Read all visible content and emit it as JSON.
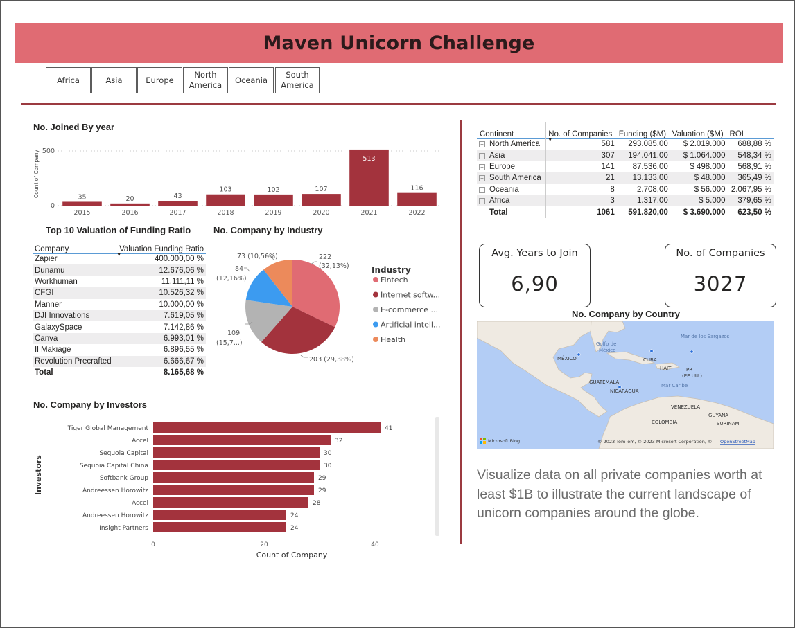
{
  "title": "Maven Unicorn Challenge",
  "slicers": [
    {
      "label": "Africa"
    },
    {
      "label": "Asia"
    },
    {
      "label": "Europe"
    },
    {
      "label": "North America"
    },
    {
      "label": "Oceania"
    },
    {
      "label": "South America"
    }
  ],
  "joined": {
    "title": "No. Joined By year",
    "ylabel": "Count of Company",
    "yticks": [
      "0",
      "500"
    ],
    "chart_data": {
      "type": "bar",
      "categories": [
        "2015",
        "2016",
        "2017",
        "2018",
        "2019",
        "2020",
        "2021",
        "2022"
      ],
      "values": [
        35,
        20,
        43,
        103,
        102,
        107,
        513,
        116
      ],
      "ylabel": "Count of Company",
      "ylim": [
        0,
        520
      ],
      "color": "#a3333d",
      "grid": true
    }
  },
  "top10": {
    "title": "Top 10 Valuation of Funding Ratio",
    "headers": {
      "company": "Company",
      "ratio": "Valuation Funding Ratio"
    },
    "rows": [
      {
        "company": "Zapier",
        "ratio": "400.000,00 %"
      },
      {
        "company": "Dunamu",
        "ratio": "12.676,06 %"
      },
      {
        "company": "Workhuman",
        "ratio": "11.111,11 %"
      },
      {
        "company": "CFGI",
        "ratio": "10.526,32 %"
      },
      {
        "company": "Manner",
        "ratio": "10.000,00 %"
      },
      {
        "company": "DJI Innovations",
        "ratio": "7.619,05 %"
      },
      {
        "company": "GalaxySpace",
        "ratio": "7.142,86 %"
      },
      {
        "company": "Canva",
        "ratio": "6.993,01 %"
      },
      {
        "company": "Il Makiage",
        "ratio": "6.896,55 %"
      },
      {
        "company": "Revolution Precrafted",
        "ratio": "6.666,67 %"
      }
    ],
    "total": {
      "label": "Total",
      "ratio": "8.165,68 %"
    }
  },
  "industry": {
    "title": "No. Company by Industry",
    "legend_title": "Industry",
    "legend": [
      "Fintech",
      "Internet softw...",
      "E-commerce ...",
      "Artificial intell...",
      "Health"
    ],
    "slice_labels": [
      {
        "line1": "222",
        "line2": "(32,13%)"
      },
      {
        "line1": "203 (29,38%)",
        "line2": ""
      },
      {
        "line1": "109",
        "line2": "(15,7...)"
      },
      {
        "line1": "84",
        "line2": "(12,16%)"
      },
      {
        "line1": "73 (10,56%)",
        "line2": ""
      }
    ],
    "chart_data": {
      "type": "pie",
      "labels": [
        "Fintech",
        "Internet softw...",
        "E-commerce ...",
        "Artificial intell...",
        "Health"
      ],
      "values": [
        222,
        203,
        109,
        84,
        73
      ],
      "colors": [
        "#e06b73",
        "#a3333d",
        "#b3b3b3",
        "#3c9bf0",
        "#ec8a5b"
      ]
    }
  },
  "investors": {
    "title": "No. Company by Investors",
    "ylabel": "Investors",
    "xlabel": "Count of Company",
    "xticks": [
      "0",
      "20",
      "40"
    ],
    "chart_data": {
      "type": "bar",
      "orientation": "horizontal",
      "categories": [
        "Tiger Global Management",
        "Accel",
        "Sequoia Capital",
        "Sequoia Capital China",
        "Softbank Group",
        "Andreessen Horowitz",
        "Accel",
        "Andreessen Horowitz",
        "Insight Partners"
      ],
      "values": [
        41,
        32,
        30,
        30,
        29,
        29,
        28,
        24,
        24
      ],
      "xlabel": "Count of Company",
      "ylabel": "Investors",
      "xlim": [
        0,
        50
      ],
      "color": "#a3333d"
    }
  },
  "continent_table": {
    "headers": {
      "continent": "Continent",
      "companies": "No. of Companies",
      "funding": "Funding ($M)",
      "valuation": "Valuation ($M)",
      "roi": "ROI"
    },
    "rows": [
      {
        "continent": "North America",
        "companies": "581",
        "funding": "293.085,00",
        "valuation": "$ 2.019.000",
        "roi": "688,88 %"
      },
      {
        "continent": "Asia",
        "companies": "307",
        "funding": "194.041,00",
        "valuation": "$ 1.064.000",
        "roi": "548,34 %"
      },
      {
        "continent": "Europe",
        "companies": "141",
        "funding": "87.536,00",
        "valuation": "$ 498.000",
        "roi": "568,91 %"
      },
      {
        "continent": "South America",
        "companies": "21",
        "funding": "13.133,00",
        "valuation": "$ 48.000",
        "roi": "365,49 %"
      },
      {
        "continent": "Oceania",
        "companies": "8",
        "funding": "2.708,00",
        "valuation": "$ 56.000",
        "roi": "2.067,95 %"
      },
      {
        "continent": "Africa",
        "companies": "3",
        "funding": "1.317,00",
        "valuation": "$ 5.000",
        "roi": "379,65 %"
      }
    ],
    "total": {
      "label": "Total",
      "companies": "1061",
      "funding": "591.820,00",
      "valuation": "$ 3.690.000",
      "roi": "623,50 %"
    }
  },
  "cards": {
    "avg_years": {
      "label": "Avg. Years to Join",
      "value": "6,90"
    },
    "companies": {
      "label": "No. of Companies",
      "value": "3027"
    }
  },
  "map": {
    "title": "No. Company by Country",
    "labels": [
      "MÉXICO",
      "Golfo de",
      "México",
      "Mar de los Sargazos",
      "CUBA",
      "HAITÍ",
      "PR",
      "(EE.UU.)",
      "Mar Caribe",
      "GUATEMALA",
      "NICARAGUA",
      "VENEZUELA",
      "GUYANA",
      "COLOMBIA",
      "SURINAM"
    ],
    "bing": "Microsoft Bing",
    "attribution": "© 2023 TomTom, © 2023 Microsoft Corporation, ©",
    "osm": "OpenStreetMap"
  },
  "description": "Visualize data on all private companies worth at least $1B to illustrate the current landscape of unicorn companies around the globe."
}
